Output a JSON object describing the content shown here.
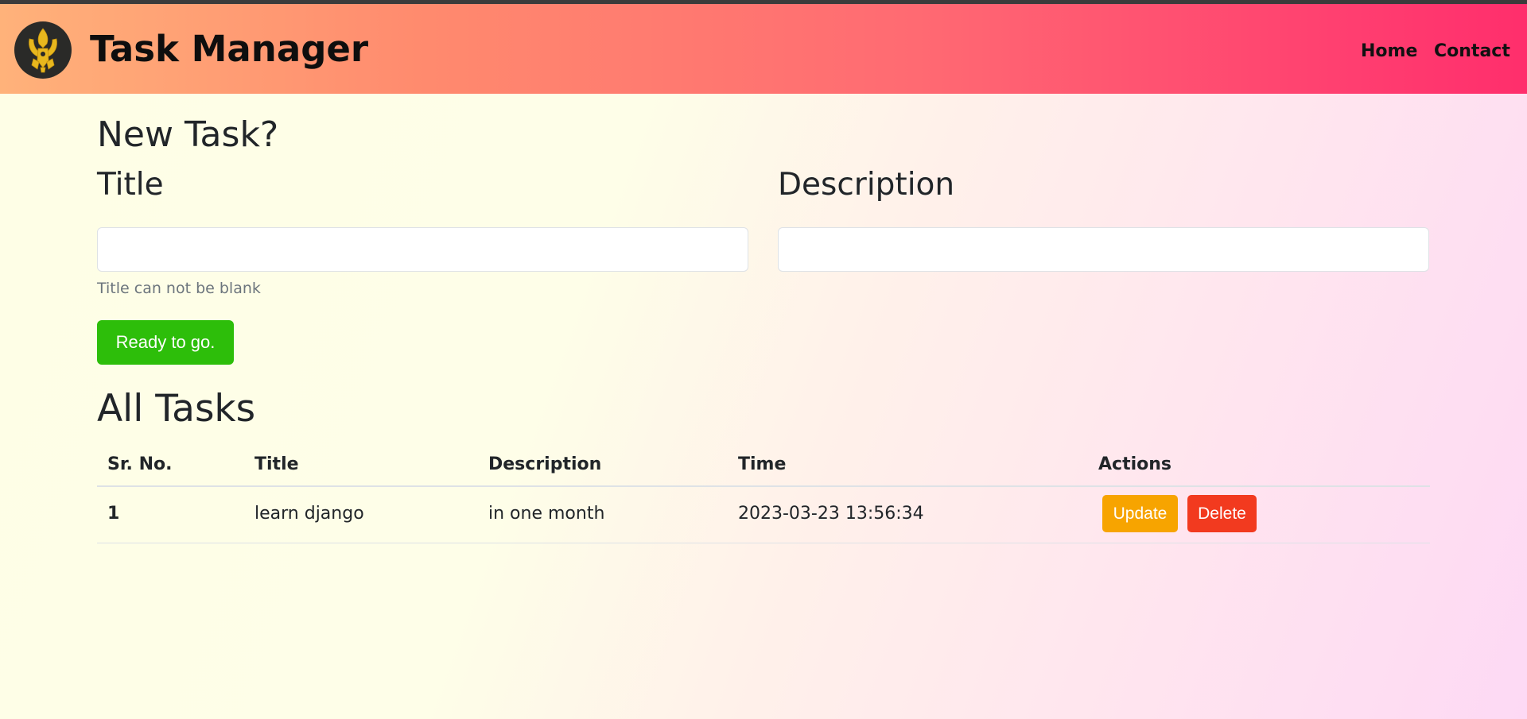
{
  "navbar": {
    "brand": "Task Manager",
    "links": [
      "Home",
      "Contact"
    ]
  },
  "form": {
    "heading": "New Task?",
    "title_label": "Title",
    "title_value": "",
    "description_label": "Description",
    "description_value": "",
    "title_help": "Title can not be blank",
    "submit_label": "Ready to go."
  },
  "tasks": {
    "heading": "All Tasks",
    "columns": [
      "Sr. No.",
      "Title",
      "Description",
      "Time",
      "Actions"
    ],
    "rows": [
      {
        "sr_no": "1",
        "title": "learn django",
        "description": "in one month",
        "time": "2023-03-23 13:56:34",
        "update_label": "Update",
        "delete_label": "Delete"
      }
    ]
  },
  "colors": {
    "submit": "#2dbe0a",
    "update": "#f7a400",
    "delete": "#f23a1f"
  },
  "icons": {
    "logo": "gold-crest-emblem-icon"
  }
}
